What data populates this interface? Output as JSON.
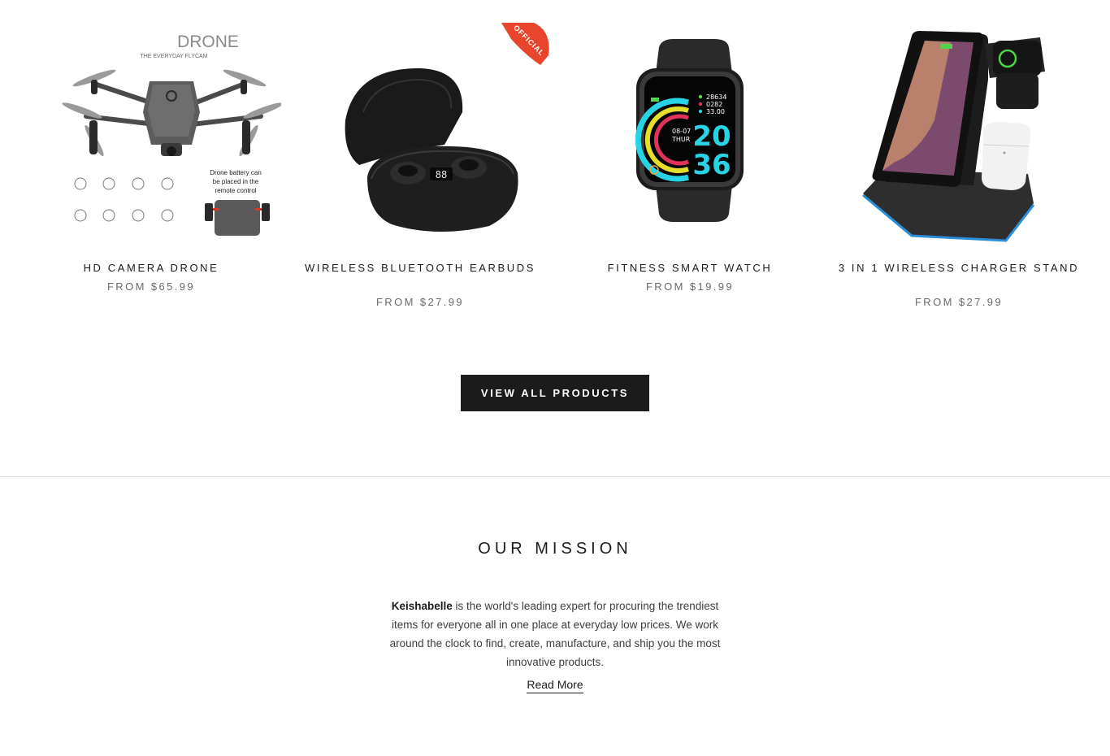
{
  "products": [
    {
      "title": "HD CAMERA DRONE",
      "price": "FROM $65.99",
      "image": {
        "brand": "DRONE",
        "tagline": "THE EVERYDAY FLYCAM",
        "battery_note_1": "Drone battery can",
        "battery_note_2": "be placed in the",
        "battery_note_3": "remote control"
      }
    },
    {
      "title": "WIRELESS BLUETOOTH EARBUDS",
      "price": "FROM $27.99",
      "image": {
        "ribbon": "OFFICIAL",
        "case_display": "88"
      }
    },
    {
      "title": "FITNESS SMART WATCH",
      "price": "FROM $19.99",
      "image": {
        "steps": "28634",
        "calories": "0282",
        "distance": "33.00",
        "date": "08-07",
        "day": "THUR",
        "hour": "20",
        "minute": "36"
      }
    },
    {
      "title": "3 IN 1 WIRELESS CHARGER STAND",
      "price": "FROM $27.99",
      "image": {}
    }
  ],
  "view_all_label": "VIEW ALL PRODUCTS",
  "mission": {
    "heading": "OUR MISSION",
    "brand": "Keishabelle",
    "body": " is the world's leading expert for procuring the trendiest items for everyone all in one place at everyday low prices. We work around the clock to find, create, manufacture, and ship you the most innovative products.",
    "read_more": "Read More"
  },
  "colors": {
    "button_bg": "#1c1b1b",
    "ribbon": "#e8452c",
    "watch_cyan": "#28d3e6",
    "charger_glow": "#2a8fd6"
  }
}
